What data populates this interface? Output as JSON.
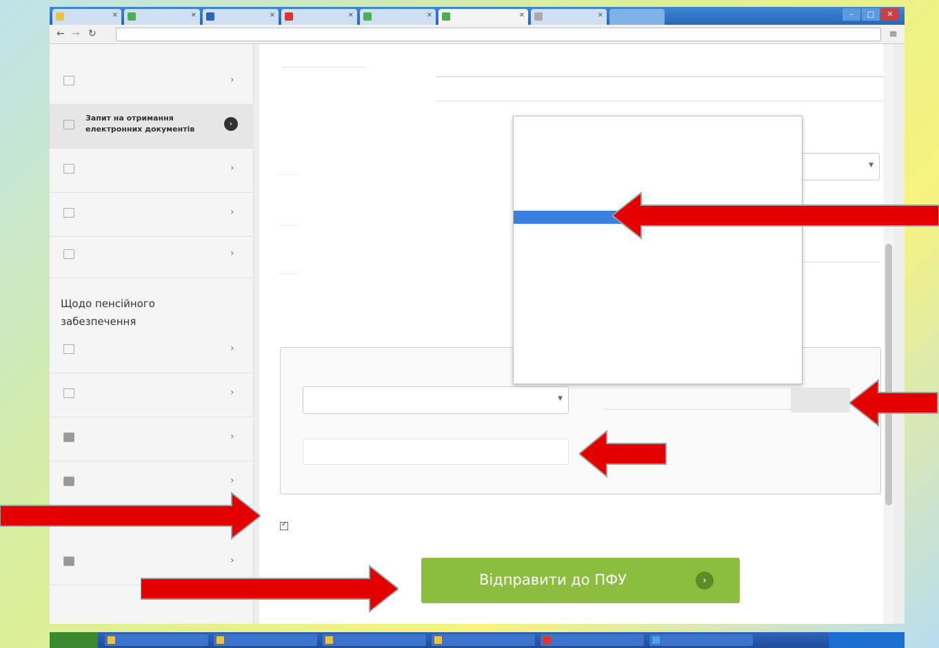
{
  "browser": {
    "tabs": [
      "",
      "",
      "",
      "",
      "",
      "",
      "",
      ""
    ],
    "address": "",
    "window_buttons": [
      "–",
      "□",
      "✕"
    ]
  },
  "sidebar": {
    "items": [
      {
        "label": "",
        "icon": "document-icon"
      },
      {
        "label": "Запит на отримання електронних документів",
        "icon": "document-icon",
        "active": true
      },
      {
        "label": "",
        "icon": "document-icon"
      },
      {
        "label": "",
        "icon": "document-icon"
      },
      {
        "label": "",
        "icon": "calendar-icon"
      }
    ],
    "section_title": "Щодо пенсійного забезпечення",
    "items2": [
      {
        "label": "",
        "icon": "document-icon"
      },
      {
        "label": "",
        "icon": "people-icon"
      },
      {
        "label": "",
        "icon": "building-icon"
      },
      {
        "label": "",
        "icon": "building-icon"
      },
      {
        "label": "",
        "icon": "building-icon"
      }
    ]
  },
  "form": {
    "dropdown_options": [
      "",
      "",
      "",
      "",
      "",
      "",
      "",
      "",
      "",
      "",
      "",
      "",
      "",
      "",
      "",
      "",
      "",
      "",
      "",
      ""
    ],
    "dropdown_highlighted_index": 7,
    "file_button": "",
    "checkbox_text": "",
    "submit_label": "Відправити до ПФУ"
  },
  "taskbar": {
    "start": "",
    "items": [
      "",
      "",
      "",
      "",
      "",
      "",
      "",
      ""
    ],
    "tray": ""
  },
  "colors": {
    "submit": "#8cbd3f",
    "arrow": "#e50000",
    "highlight": "#3b7fe0"
  }
}
